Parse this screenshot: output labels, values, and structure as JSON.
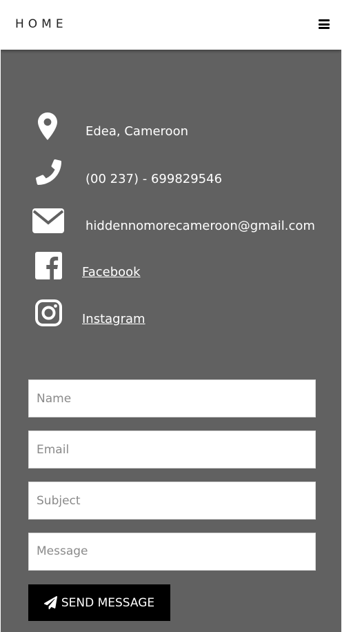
{
  "header": {
    "title": "HOME",
    "menu_icon": "hamburger-menu-icon"
  },
  "contact": {
    "location": {
      "icon": "map-marker-icon",
      "text": "Edea, Cameroon"
    },
    "phone": {
      "icon": "phone-icon",
      "text": "(00 237) - 699829546"
    },
    "email": {
      "icon": "envelope-icon",
      "text": "hiddennomorecameroon@gmail.com"
    },
    "facebook": {
      "icon": "facebook-icon",
      "text": "Facebook"
    },
    "instagram": {
      "icon": "instagram-icon",
      "text": "Instagram"
    }
  },
  "form": {
    "name": {
      "placeholder": "Name",
      "value": ""
    },
    "email": {
      "placeholder": "Email",
      "value": ""
    },
    "subject": {
      "placeholder": "Subject",
      "value": ""
    },
    "message": {
      "placeholder": "Message",
      "value": ""
    },
    "submit": {
      "icon": "paper-plane-icon",
      "label": "SEND MESSAGE"
    }
  },
  "colors": {
    "background": "#616161",
    "header_bg": "#ffffff",
    "text": "#ffffff",
    "button_bg": "#000000"
  }
}
